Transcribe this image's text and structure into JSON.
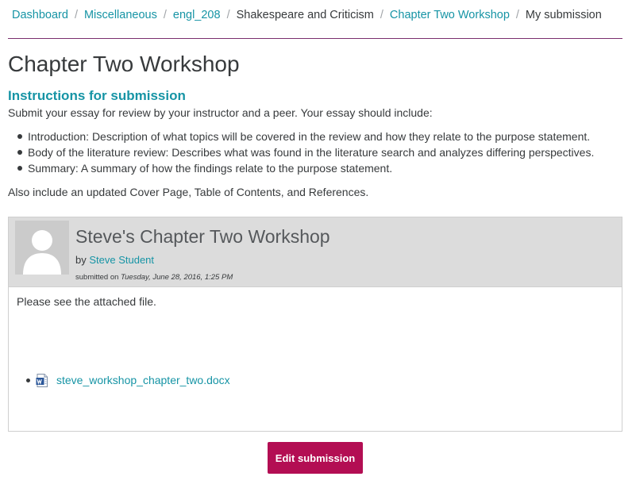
{
  "breadcrumb": {
    "items": [
      {
        "label": "Dashboard"
      },
      {
        "label": "Miscellaneous"
      },
      {
        "label": "engl_208"
      },
      {
        "label": "Shakespeare and Criticism"
      },
      {
        "label": "Chapter Two Workshop"
      },
      {
        "label": "My submission"
      }
    ],
    "separator": "/"
  },
  "page": {
    "title": "Chapter Two Workshop"
  },
  "instructions": {
    "heading": "Instructions for submission",
    "intro": "Submit your essay for review by your instructor and a peer. Your essay should include:",
    "items": [
      "Introduction: Description of what topics will be covered in the review and how they relate to the purpose statement.",
      "Body of the literature review: Describes what was found in the literature search and analyzes differing perspectives.",
      "Summary: A summary of how the findings relate to the purpose statement."
    ],
    "also": "Also include an updated Cover Page, Table of Contents, and References."
  },
  "submission": {
    "title": "Steve's Chapter Two Workshop",
    "by_prefix": "by",
    "author": "Steve Student",
    "submitted_prefix": "submitted on",
    "submitted_date": "Tuesday, June 28, 2016, 1:25 PM",
    "body": "Please see the attached file.",
    "attachment": {
      "filename": "steve_workshop_chapter_two.docx",
      "icon": "word-document-icon"
    }
  },
  "actions": {
    "edit_label": "Edit submission"
  },
  "colors": {
    "link": "#1694a5",
    "accent": "#b30e53",
    "rule": "#7b2e6e",
    "header_bg": "#dcdcdc"
  }
}
